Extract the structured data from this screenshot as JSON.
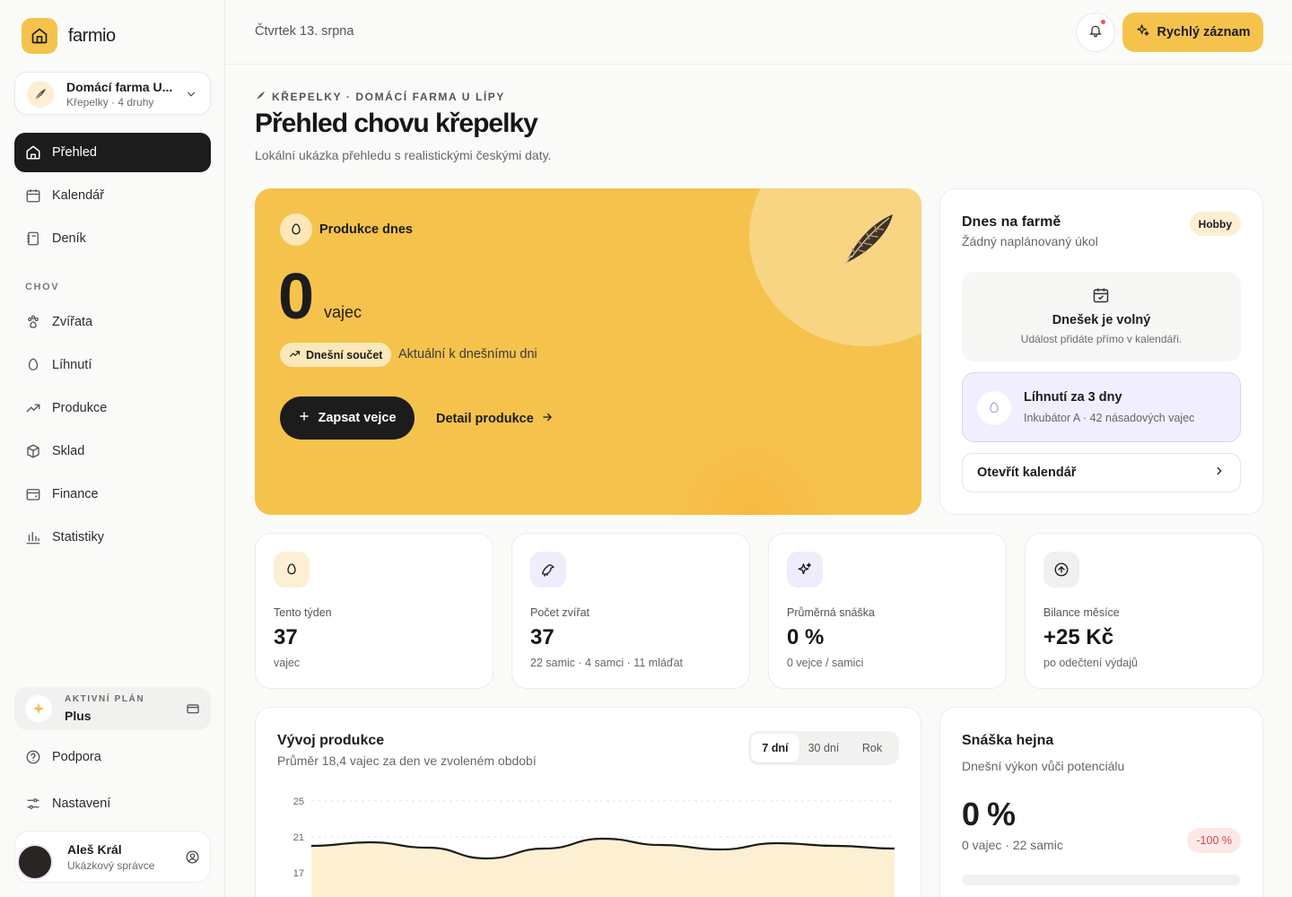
{
  "brand": {
    "name": "farmio"
  },
  "farm": {
    "name": "Domácí farma U...",
    "sub": "Křepelky · 4 druhy"
  },
  "nav": {
    "main": [
      {
        "label": "Přehled",
        "icon": "home-icon"
      },
      {
        "label": "Kalendář",
        "icon": "calendar-icon"
      },
      {
        "label": "Deník",
        "icon": "journal-icon"
      }
    ],
    "section": "CHOV",
    "chov": [
      {
        "label": "Zvířata",
        "icon": "paw-icon"
      },
      {
        "label": "Líhnutí",
        "icon": "egg-icon"
      },
      {
        "label": "Produkce",
        "icon": "trend-icon"
      },
      {
        "label": "Sklad",
        "icon": "box-icon"
      },
      {
        "label": "Finance",
        "icon": "wallet-icon"
      },
      {
        "label": "Statistiky",
        "icon": "bar-chart-icon"
      }
    ]
  },
  "plan": {
    "label": "AKTIVNÍ PLÁN",
    "name": "Plus"
  },
  "footer_nav": [
    {
      "label": "Podpora",
      "icon": "help-icon"
    },
    {
      "label": "Nastavení",
      "icon": "settings-icon"
    }
  ],
  "user": {
    "name": "Aleš Král",
    "role": "Ukázkový správce"
  },
  "topbar": {
    "date": "Čtvrtek 13. srpna",
    "quick_label": "Rychlý záznam"
  },
  "page": {
    "breadcrumb": "KŘEPELKY · DOMÁCÍ FARMA U LÍPY",
    "title": "Přehled chovu křepelky",
    "subtitle": "Lokální ukázka přehledu s realistickými českými daty."
  },
  "hero": {
    "label": "Produkce dnes",
    "value": "0",
    "unit": "vajec",
    "pill": "Dnešní součet",
    "note": "Aktuální k dnešnímu dni",
    "button": "Zapsat vejce",
    "link": "Detail produkce"
  },
  "today": {
    "title": "Dnes na farmě",
    "sub": "Žádný naplánovaný úkol",
    "badge": "Hobby",
    "free_title": "Dnešek je volný",
    "free_sub": "Událost přidáte přímo v kalendáři.",
    "hatch_title": "Líhnutí za 3 dny",
    "hatch_sub": "Inkubátor A · 42 násadových vajec",
    "calendar_btn": "Otevřít kalendář"
  },
  "stats": [
    {
      "label": "Tento týden",
      "value": "37",
      "sub": "vajec",
      "icon": "egg-icon",
      "bg": "#fcefd3"
    },
    {
      "label": "Počet zvířat",
      "value": "37",
      "sub": "22 samic · 4 samci · 11 mláďat",
      "icon": "bird-icon",
      "bg": "#efedfb"
    },
    {
      "label": "Průměrná snáška",
      "value": "0 %",
      "sub": "0 vejce / samici",
      "icon": "sparkle-icon",
      "bg": "#efedfb"
    },
    {
      "label": "Bilance měsíce",
      "value": "+25 Kč",
      "sub": "po odečtení výdajů",
      "icon": "arrow-up-circle-icon",
      "bg": "#f0f0ee"
    }
  ],
  "production": {
    "title": "Vývoj produkce",
    "sub": "Průměr 18,4 vajec za den ve zvoleném období",
    "ranges": [
      "7 dní",
      "30 dní",
      "Rok"
    ],
    "active_range": "7 dní"
  },
  "chart_data": {
    "type": "area",
    "yticks": [
      "25",
      "21",
      "17"
    ],
    "ylim": [
      17,
      25
    ],
    "values": [
      20.0,
      20.4,
      19.8,
      18.6,
      19.7,
      20.8,
      20.1,
      19.6,
      20.3,
      20.0,
      19.7
    ]
  },
  "flock": {
    "title": "Snáška hejna",
    "sub": "Dnešní výkon vůči potenciálu",
    "value": "0 %",
    "note": "0 vajec · 22 samic",
    "badge": "-100 %",
    "fill": 0
  },
  "colors": {
    "accent": "#f5c24c",
    "dark": "#1c1c1c",
    "lavender": "#f1efff"
  }
}
